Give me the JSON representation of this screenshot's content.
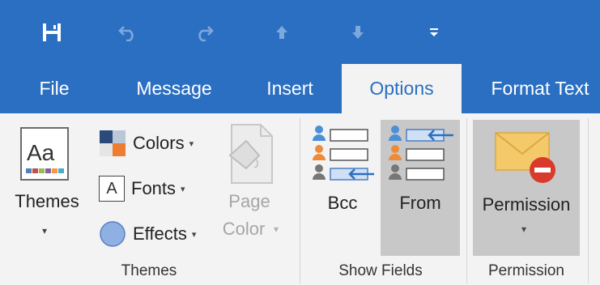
{
  "colors": {
    "title_bar": "#2b6fc2",
    "ribbon_bg": "#f3f3f3",
    "pressed_bg": "#c8c8c8",
    "disabled_text": "#a6a6a6"
  },
  "quick_access": [
    {
      "icon": "save-icon"
    },
    {
      "icon": "undo-icon"
    },
    {
      "icon": "redo-icon"
    },
    {
      "icon": "previous-item-icon"
    },
    {
      "icon": "next-item-icon"
    },
    {
      "icon": "customize-quick-access-icon"
    }
  ],
  "tabs": [
    {
      "label": "File"
    },
    {
      "label": "Message"
    },
    {
      "label": "Insert"
    },
    {
      "label": "Options",
      "active": true
    },
    {
      "label": "Format Text"
    }
  ],
  "themes_group": {
    "themes_label": "Themes",
    "colors_label": "Colors",
    "fonts_label": "Fonts",
    "effects_label": "Effects",
    "page_color_line1": "Page",
    "page_color_line2": "Color",
    "fonts_glyph": "A",
    "group_label": "Themes"
  },
  "show_fields_group": {
    "bcc_label": "Bcc",
    "from_label": "From",
    "group_label": "Show Fields"
  },
  "permission_group": {
    "permission_label": "Permission",
    "group_label": "Permission"
  },
  "caret_glyph": "▾",
  "themes_icon_text": "Aa"
}
